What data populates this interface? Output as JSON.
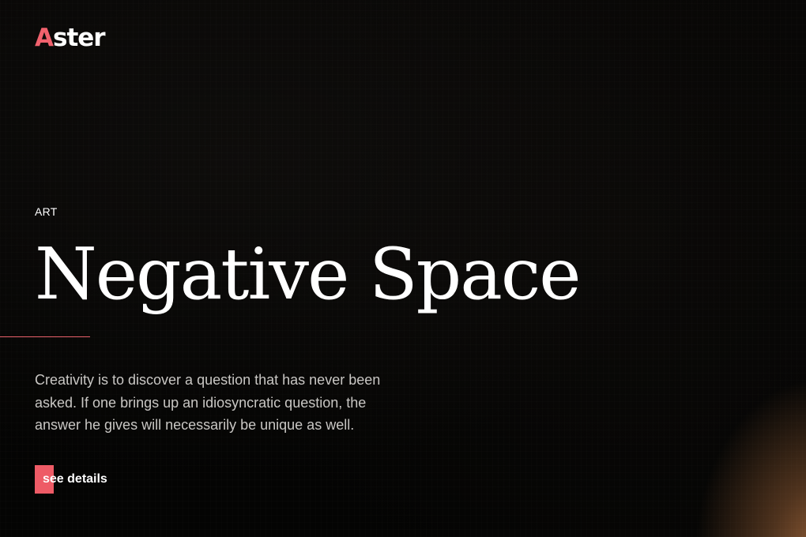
{
  "brand": {
    "logo_first_letter": "A",
    "logo_rest": "ster",
    "accent_color": "#ee5b66"
  },
  "hero": {
    "category": "ART",
    "title": "Negative Space",
    "description": "Creativity is to discover a question that has never been asked. If one brings up an idiosyncratic question, the answer he gives will necessarily be unique as well.",
    "cta_label": "see details"
  }
}
